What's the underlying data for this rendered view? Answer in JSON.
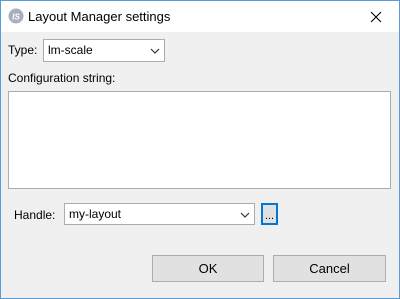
{
  "window": {
    "title": "Layout Manager settings",
    "app_icon": "is-logo-icon",
    "close_icon": "close-icon"
  },
  "form": {
    "type_label": "Type:",
    "type_value": "lm-scale",
    "config_label": "Configuration string:",
    "config_value": "",
    "handle_label": "Handle:",
    "handle_value": "my-layout",
    "browse_label": "..."
  },
  "buttons": {
    "ok_label": "OK",
    "cancel_label": "Cancel"
  },
  "colors": {
    "window_border": "#5a9bd5",
    "focus_accent": "#0078d7",
    "dialog_bg": "#f0f0f0",
    "button_bg": "#e1e1e1"
  }
}
